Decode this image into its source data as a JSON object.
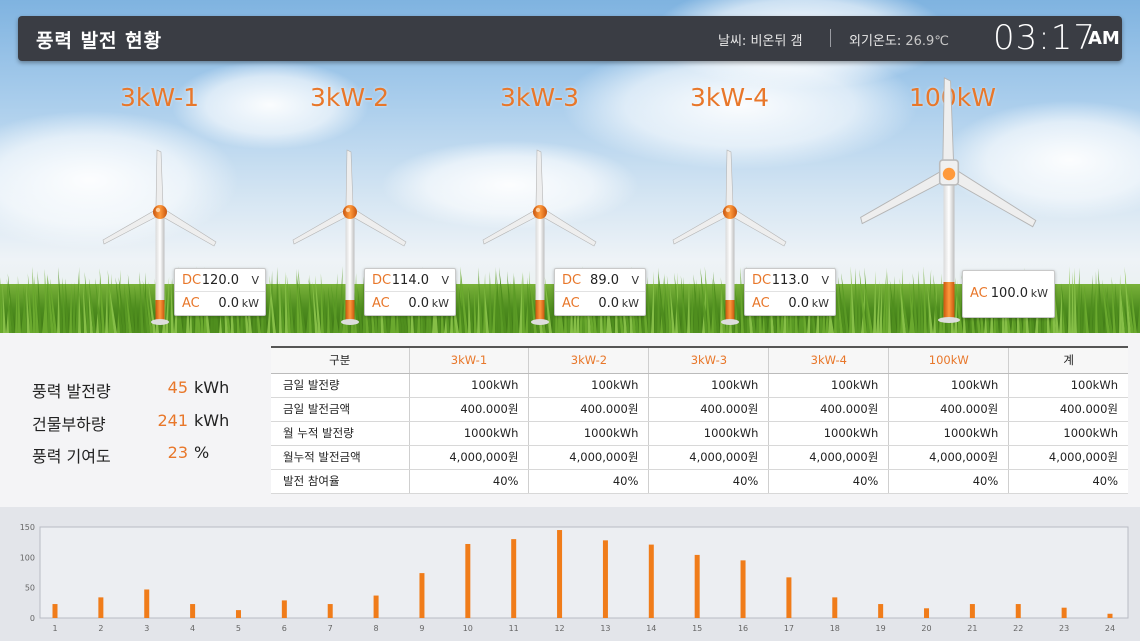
{
  "header": {
    "title": "풍력 발전 현황",
    "weather_label": "날씨:",
    "weather_value": "비온뒤 갬",
    "temp_label": "외기온도:",
    "temp_value": "26.9℃",
    "time": "03:17",
    "ampm": "AM"
  },
  "turbines": [
    {
      "label": "3kW-1",
      "dc_label": "DC",
      "dc_value": "120.0",
      "dc_unit": "V",
      "ac_label": "AC",
      "ac_value": "0.0",
      "ac_unit": "kW"
    },
    {
      "label": "3kW-2",
      "dc_label": "DC",
      "dc_value": "114.0",
      "dc_unit": "V",
      "ac_label": "AC",
      "ac_value": "0.0",
      "ac_unit": "kW"
    },
    {
      "label": "3kW-3",
      "dc_label": "DC",
      "dc_value": "89.0",
      "dc_unit": "V",
      "ac_label": "AC",
      "ac_value": "0.0",
      "ac_unit": "kW"
    },
    {
      "label": "3kW-4",
      "dc_label": "DC",
      "dc_value": "113.0",
      "dc_unit": "V",
      "ac_label": "AC",
      "ac_value": "0.0",
      "ac_unit": "kW"
    },
    {
      "label": "100kW",
      "ac_label": "AC",
      "ac_value": "100.0",
      "ac_unit": "kW"
    }
  ],
  "summary": [
    {
      "label": "풍력 발전량",
      "value": "45",
      "unit": "kWh"
    },
    {
      "label": "건물부하량",
      "value": "241",
      "unit": "kWh"
    },
    {
      "label": "풍력 기여도",
      "value": "23",
      "unit": "%"
    }
  ],
  "table": {
    "headers": [
      "구분",
      "3kW-1",
      "3kW-2",
      "3kW-3",
      "3kW-4",
      "100kW",
      "계"
    ],
    "rows": [
      [
        "금일 발전량",
        "100kWh",
        "100kWh",
        "100kWh",
        "100kWh",
        "100kWh",
        "100kWh"
      ],
      [
        "금일 발전금액",
        "400.000원",
        "400.000원",
        "400.000원",
        "400.000원",
        "400.000원",
        "400.000원"
      ],
      [
        "월 누적 발전량",
        "1000kWh",
        "1000kWh",
        "1000kWh",
        "1000kWh",
        "1000kWh",
        "1000kWh"
      ],
      [
        "월누적 발전금액",
        "4,000,000원",
        "4,000,000원",
        "4,000,000원",
        "4,000,000원",
        "4,000,000원",
        "4,000,000원"
      ],
      [
        "발전 참여율",
        "40%",
        "40%",
        "40%",
        "40%",
        "40%",
        "40%"
      ]
    ]
  },
  "colors": {
    "accent": "#e8772a",
    "bar": "#f07c1a"
  },
  "chart_data": {
    "type": "bar",
    "categories": [
      "1",
      "2",
      "3",
      "4",
      "5",
      "6",
      "7",
      "8",
      "9",
      "10",
      "11",
      "12",
      "13",
      "14",
      "15",
      "16",
      "17",
      "18",
      "19",
      "20",
      "21",
      "22",
      "23",
      "24"
    ],
    "values": [
      23,
      34,
      47,
      23,
      13,
      29,
      23,
      37,
      74,
      122,
      130,
      145,
      128,
      121,
      104,
      95,
      67,
      34,
      23,
      16,
      23,
      23,
      17,
      7
    ],
    "yticks": [
      "0",
      "50",
      "100",
      "150"
    ],
    "ylim": [
      0,
      150
    ],
    "grid": false
  }
}
